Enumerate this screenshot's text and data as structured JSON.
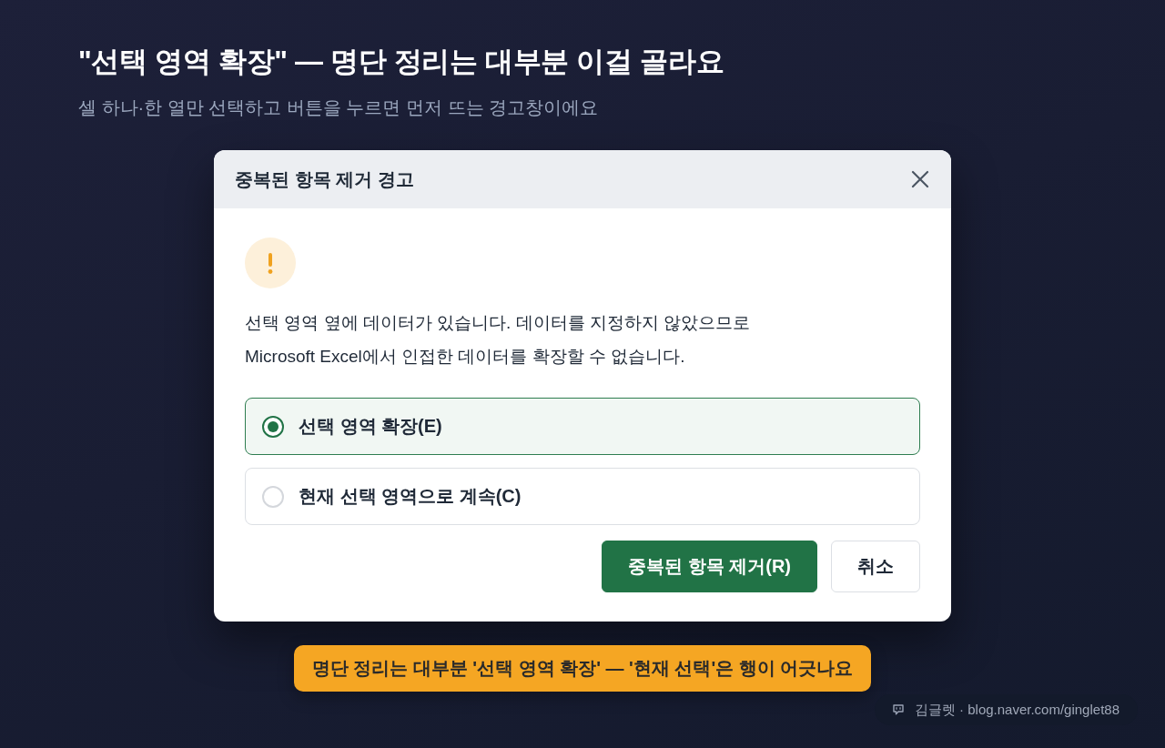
{
  "heading": {
    "title": "\"선택 영역 확장\" — 명단 정리는 대부분 이걸 골라요",
    "subtitle": "셀 하나·한 열만 선택하고 버튼을 누르면 먼저 뜨는 경고창이에요"
  },
  "dialog": {
    "title": "중복된 항목 제거 경고",
    "message": [
      "선택 영역 옆에 데이터가 있습니다. 데이터를 지정하지 않았으므로",
      "Microsoft Excel에서 인접한 데이터를 확장할 수 없습니다."
    ],
    "options": [
      {
        "label": "선택 영역 확장(E)",
        "selected": true
      },
      {
        "label": "현재 선택 영역으로 계속(C)",
        "selected": false
      }
    ],
    "buttons": [
      {
        "label": "중복된 항목 제거(R)",
        "kind": "primary"
      },
      {
        "label": "취소",
        "kind": "secondary"
      }
    ]
  },
  "callout": "명단 정리는 대부분 '선택 영역 확장' — '현재 선택'은 행이 어긋나요",
  "credit": "김글렛 · blog.naver.com/ginglet88"
}
